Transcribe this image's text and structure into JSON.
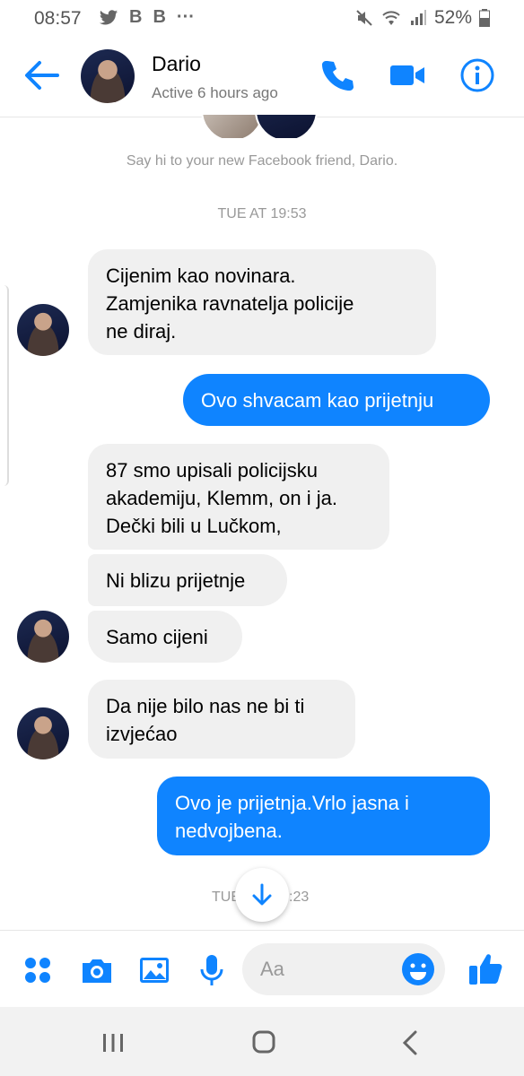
{
  "status_bar": {
    "time": "08:57",
    "notification_icons": [
      "twitter-icon",
      "B-app-icon",
      "B-app-icon"
    ],
    "more": "···",
    "battery": "52%"
  },
  "header": {
    "contact_name": "Dario",
    "contact_status": "Active 6 hours ago",
    "accent_color": "#0f84ff"
  },
  "conversation": {
    "say_hi": "Say hi to your new Facebook friend, Dario.",
    "timestamp_1": "TUE AT 19:53",
    "timestamp_2_left": "TUE",
    "timestamp_2_right": ":23",
    "messages": [
      {
        "sender": "contact",
        "text": "Cijenim kao novinara.\nZamjenika ravnatelja policije\nne diraj."
      },
      {
        "sender": "me",
        "text": "Ovo shvacam kao prijetnju"
      },
      {
        "sender": "contact",
        "text": "87 smo upisali policijsku\nakademiju, Klemm, on i ja.\nDečki bili u Lučkom,"
      },
      {
        "sender": "contact",
        "text": "Ni blizu prijetnje"
      },
      {
        "sender": "contact",
        "text": "Samo cijeni"
      },
      {
        "sender": "contact",
        "text": "Da nije bilo nas ne bi ti\nizvjećao"
      },
      {
        "sender": "me",
        "text": "Ovo je prijetnja.Vrlo jasna i\nnedvojbena."
      }
    ],
    "incoming_bubble_color": "#f0f0f0",
    "outgoing_bubble_color": "#0f84ff"
  },
  "composer": {
    "placeholder": "Aa",
    "icons": [
      "more-apps-icon",
      "camera-icon",
      "gallery-icon",
      "microphone-icon",
      "emoji-icon",
      "like-icon"
    ]
  }
}
